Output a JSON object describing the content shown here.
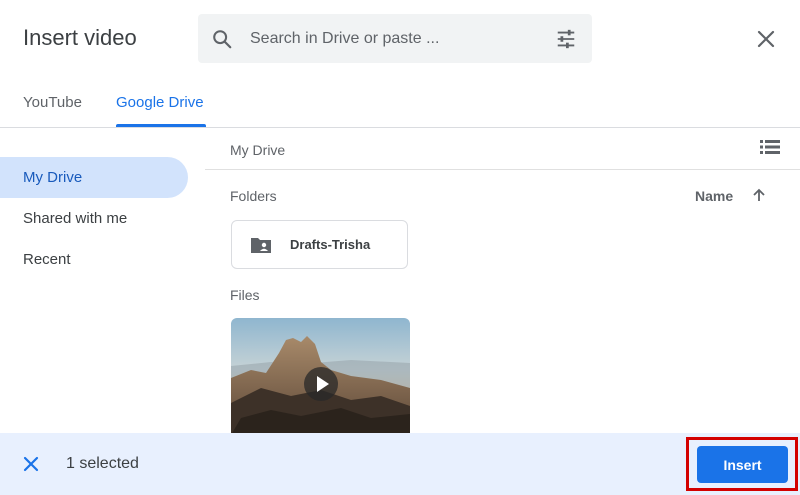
{
  "header": {
    "title": "Insert video",
    "search": {
      "placeholder": "Search in Drive or paste ...",
      "value": ""
    }
  },
  "tabs": [
    {
      "label": "YouTube"
    },
    {
      "label": "Google Drive"
    }
  ],
  "sidebar": {
    "items": [
      {
        "label": "My Drive"
      },
      {
        "label": "Shared with me"
      },
      {
        "label": "Recent"
      }
    ]
  },
  "main": {
    "breadcrumb": "My Drive",
    "folders_label": "Folders",
    "sort_label": "Name",
    "folders": [
      {
        "name": "Drafts-Trisha"
      }
    ],
    "files_label": "Files"
  },
  "footer": {
    "selected_text": "1 selected",
    "insert_label": "Insert"
  },
  "colors": {
    "accent": "#1a73e8",
    "selected_bg": "#d2e3fc",
    "bottom_bar_bg": "#e8f0fe",
    "highlight_border": "#d30000"
  },
  "icons": [
    "search-icon",
    "tune-icon",
    "close-icon",
    "list-view-icon",
    "arrow-up-icon",
    "folder-shared-icon",
    "play-icon"
  ]
}
